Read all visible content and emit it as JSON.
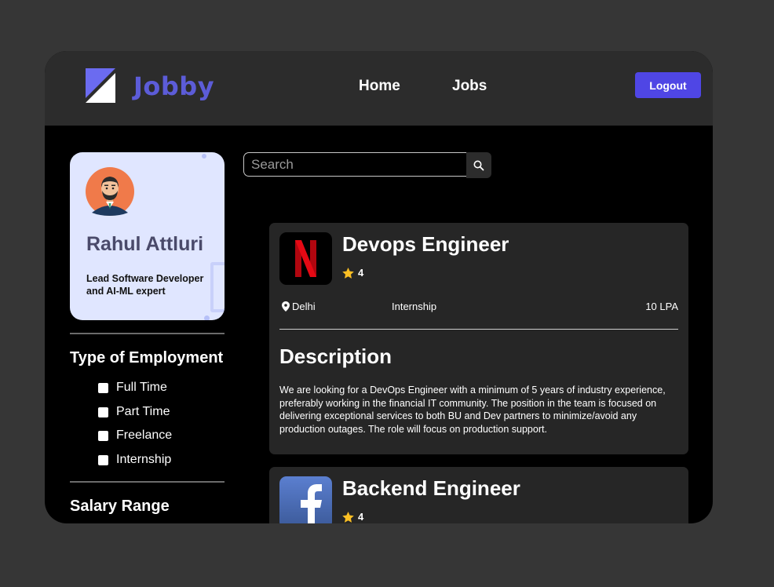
{
  "navbar": {
    "brand": "Jobby",
    "links": {
      "home": "Home",
      "jobs": "Jobs"
    },
    "logout_label": "Logout"
  },
  "profile": {
    "name": "Rahul Attluri",
    "bio": "Lead Software Developer and AI-ML expert"
  },
  "filters": {
    "employment_heading": "Type of Employment",
    "employment_options": [
      "Full Time",
      "Part Time",
      "Freelance",
      "Internship"
    ],
    "salary_heading": "Salary Range"
  },
  "search": {
    "placeholder": "Search"
  },
  "jobs": [
    {
      "title": "Devops Engineer",
      "rating": "4",
      "location": "Delhi",
      "employment_type": "Internship",
      "package": "10 LPA",
      "description_heading": "Description",
      "description": "We are looking for a DevOps Engineer with a minimum of 5 years of industry experience, preferably working in the financial IT community. The position in the team is focused on delivering exceptional services to both BU and Dev partners to minimize/avoid any production outages. The role will focus on production support.",
      "logo_icon": "netflix-logo"
    },
    {
      "title": "Backend Engineer",
      "rating": "4",
      "logo_icon": "facebook-logo"
    }
  ],
  "colors": {
    "accent": "#4f46e5",
    "brand": "#5c5cd8",
    "star": "#fbbf24"
  }
}
